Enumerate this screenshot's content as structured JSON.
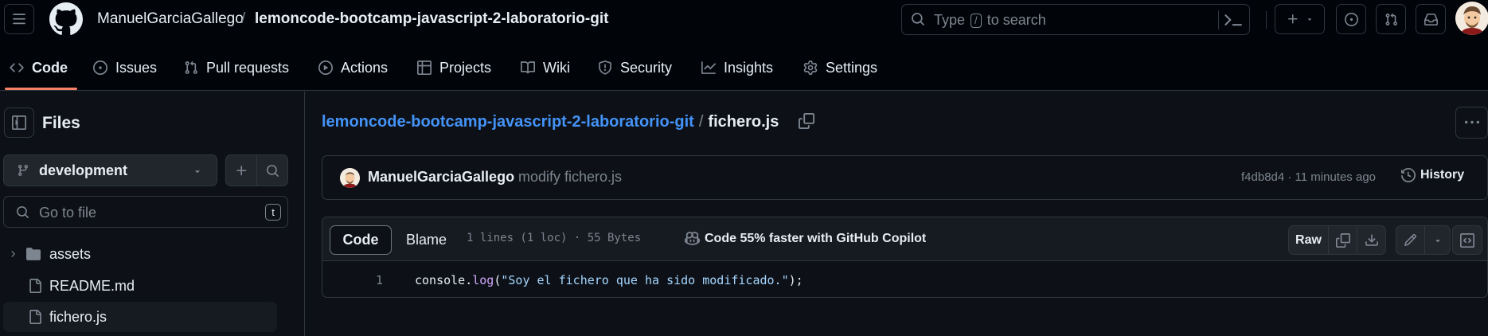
{
  "header": {
    "owner": "ManuelGarciaGallego",
    "separator": "/",
    "repo": "lemoncode-bootcamp-javascript-2-laboratorio-git",
    "search": {
      "prefix": "Type",
      "key": "/",
      "suffix": "to search"
    }
  },
  "tabs": [
    {
      "label": "Code",
      "icon": "code-icon",
      "active": true
    },
    {
      "label": "Issues",
      "icon": "issue-icon"
    },
    {
      "label": "Pull requests",
      "icon": "pull-request-icon"
    },
    {
      "label": "Actions",
      "icon": "play-icon"
    },
    {
      "label": "Projects",
      "icon": "table-icon"
    },
    {
      "label": "Wiki",
      "icon": "book-icon"
    },
    {
      "label": "Security",
      "icon": "shield-icon"
    },
    {
      "label": "Insights",
      "icon": "graph-icon"
    },
    {
      "label": "Settings",
      "icon": "gear-icon"
    }
  ],
  "sidebar": {
    "title": "Files",
    "branch": "development",
    "goto_placeholder": "Go to file",
    "goto_key": "t",
    "tree": [
      {
        "label": "assets",
        "type": "folder"
      },
      {
        "label": "README.md",
        "type": "file"
      },
      {
        "label": "fichero.js",
        "type": "file",
        "selected": true
      }
    ]
  },
  "main": {
    "path_repo": "lemoncode-bootcamp-javascript-2-laboratorio-git",
    "path_sep": "/",
    "path_file": "fichero.js",
    "commit": {
      "author": "ManuelGarciaGallego",
      "message": "modify fichero.js",
      "meta": "f4db8d4 · 11 minutes ago",
      "history_label": "History"
    },
    "file": {
      "tab_code": "Code",
      "tab_blame": "Blame",
      "info": "1 lines (1 loc) · 55 Bytes",
      "copilot": "Code 55% faster with GitHub Copilot",
      "raw_label": "Raw",
      "line_number": "1",
      "code": {
        "obj": "console.",
        "fn": "log",
        "open": "(",
        "str": "\"Soy el fichero que ha sido modificado.\"",
        "close": ");"
      }
    }
  },
  "colors": {
    "accent_link": "#4493f8",
    "tab_underline": "#f78166",
    "background": "#0d1117",
    "header_background": "#010409"
  }
}
